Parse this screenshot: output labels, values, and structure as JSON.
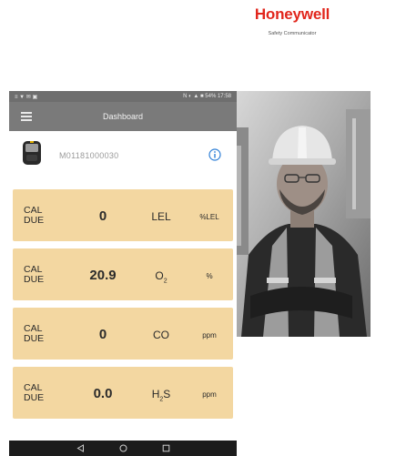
{
  "brand": {
    "name": "Honeywell",
    "tagline": "Safety Communicator"
  },
  "status_bar": {
    "left": "≡ ▼ ✉ ▣",
    "right": "N ◐ ▲ ■ 54% 17:58"
  },
  "app_bar": {
    "title": "Dashboard"
  },
  "device": {
    "serial": "M01181000030"
  },
  "readings": [
    {
      "status": "CAL DUE",
      "value": "0",
      "gas": "LEL",
      "unit": "%LEL"
    },
    {
      "status": "CAL DUE",
      "value": "20.9",
      "gas": "O",
      "gas_sub": "2",
      "unit": "%"
    },
    {
      "status": "CAL DUE",
      "value": "0",
      "gas": "CO",
      "unit": "ppm"
    },
    {
      "status": "CAL DUE",
      "value": "0.0",
      "gas": "H",
      "gas_sub": "2",
      "gas_after": "S",
      "unit": "ppm"
    }
  ],
  "colors": {
    "card_bg": "#f3d7a1",
    "app_bar": "#7a7a7a",
    "brand_red": "#e1261c",
    "info_blue": "#2f7fd6"
  },
  "icons": [
    "menu-icon",
    "gas-detector-icon",
    "info-icon",
    "back-icon",
    "home-icon",
    "recents-icon"
  ]
}
